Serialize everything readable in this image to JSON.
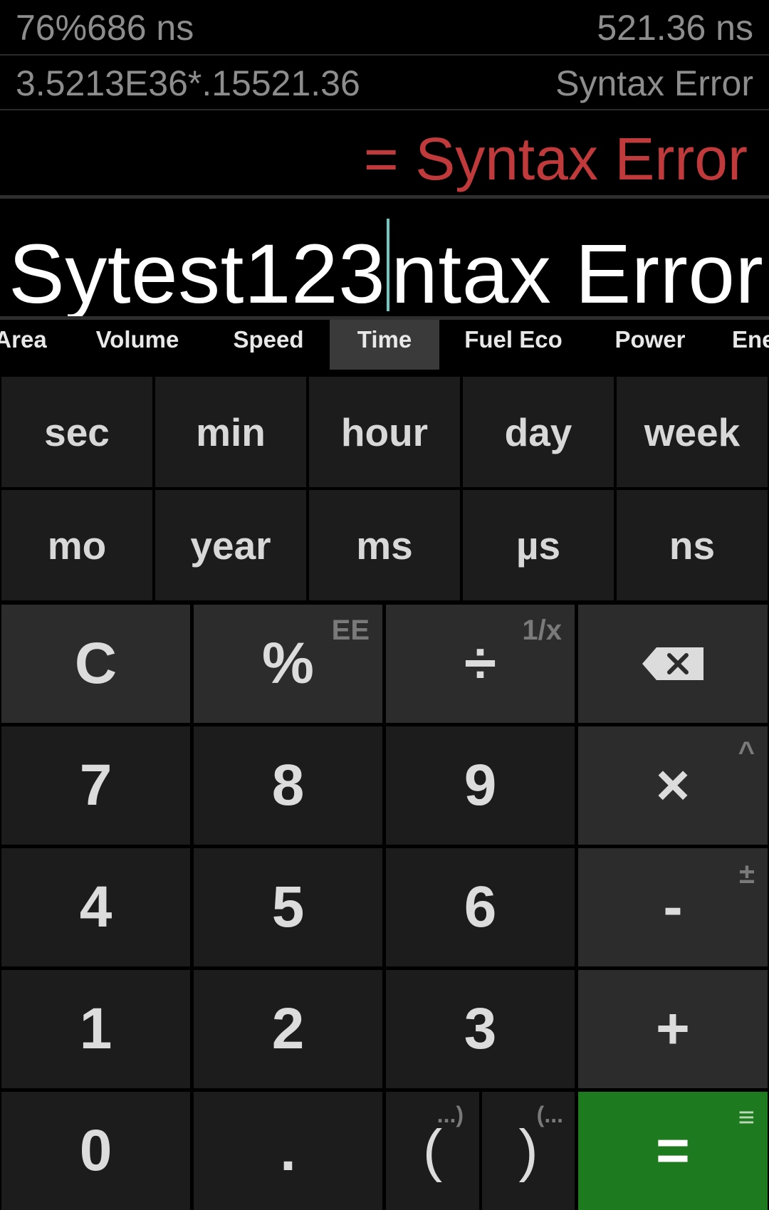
{
  "history": [
    {
      "expression": "76%686 ns",
      "result": "521.36 ns"
    },
    {
      "expression": "3.5213E36*.15521.36",
      "result": "Syntax Error"
    }
  ],
  "result": "= Syntax Error",
  "input": {
    "before_cursor": "Sytest123",
    "after_cursor": "ntax Error"
  },
  "unit_categories": [
    "Area",
    "Volume",
    "Speed",
    "Time",
    "Fuel Eco",
    "Power",
    "Ene"
  ],
  "active_category": "Time",
  "time_units": [
    "sec",
    "min",
    "hour",
    "day",
    "week",
    "mo",
    "year",
    "ms",
    "µs",
    "ns"
  ],
  "keys": {
    "clear": "C",
    "percent": "%",
    "percent_alt": "EE",
    "divide": "÷",
    "divide_alt": "1/x",
    "backspace_icon": "backspace-icon",
    "seven": "7",
    "eight": "8",
    "nine": "9",
    "multiply": "×",
    "multiply_alt": "^",
    "four": "4",
    "five": "5",
    "six": "6",
    "minus": "-",
    "minus_alt": "±",
    "one": "1",
    "two": "2",
    "three": "3",
    "plus": "+",
    "zero": "0",
    "decimal": ".",
    "open_paren": "(",
    "open_paren_alt": "...)",
    "close_paren": ")",
    "close_paren_alt": "(...",
    "equals": "=",
    "equals_alt": "≡"
  },
  "colors": {
    "error": "#c0393b",
    "equals_bg": "#1e7a1e",
    "cursor": "#6fc7c0"
  }
}
